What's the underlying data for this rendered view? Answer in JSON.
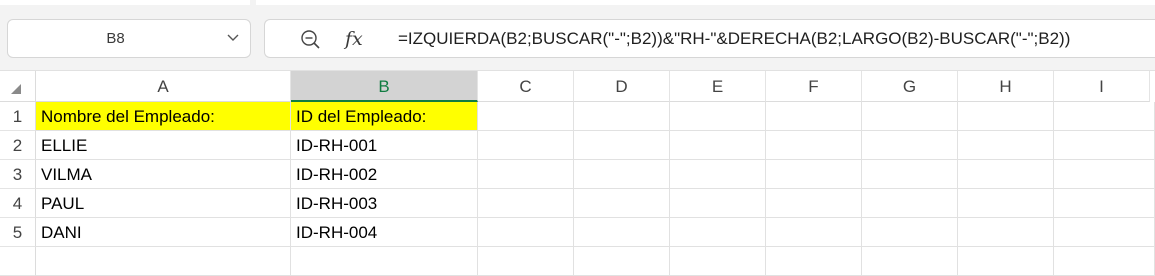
{
  "name_box": {
    "value": "B8"
  },
  "formula_bar": {
    "zoom_icon": "zoom-out-icon",
    "fx_label": "fx",
    "formula": "=IZQUIERDA(B2;BUSCAR(\"-\";B2))&\"RH-\"&DERECHA(B2;LARGO(B2)-BUSCAR(\"-\";B2))"
  },
  "grid": {
    "columns": [
      "A",
      "B",
      "C",
      "D",
      "E",
      "F",
      "G",
      "H",
      "I"
    ],
    "selected_column": "B",
    "rows": [
      {
        "number": "1",
        "A": "Nombre del Empleado:",
        "B": "ID del Empleado:"
      },
      {
        "number": "2",
        "A": "ELLIE",
        "B": "ID-RH-001"
      },
      {
        "number": "3",
        "A": "VILMA",
        "B": "ID-RH-002"
      },
      {
        "number": "4",
        "A": "PAUL",
        "B": "ID-RH-003"
      },
      {
        "number": "5",
        "A": "DANI",
        "B": "ID-RH-004"
      }
    ]
  },
  "colors": {
    "header_highlight": "#ffff00",
    "selected_accent": "#107c41"
  }
}
